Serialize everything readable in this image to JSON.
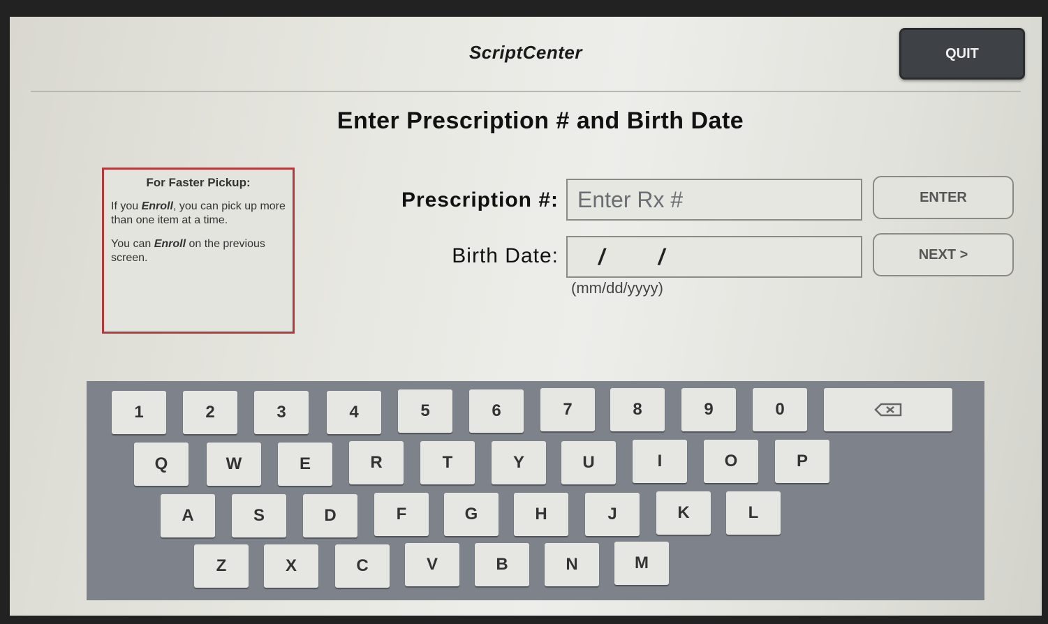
{
  "app": {
    "title": "ScriptCenter",
    "quit_label": "QUIT"
  },
  "page": {
    "title": "Enter Prescription # and Birth Date"
  },
  "info_box": {
    "heading": "For Faster Pickup:",
    "paragraph1_pre": "If you ",
    "paragraph1_em": "Enroll",
    "paragraph1_post": ", you can pick up more than one item at a time.",
    "paragraph2_pre": "You can ",
    "paragraph2_em": "Enroll",
    "paragraph2_post": " on the previous screen."
  },
  "form": {
    "rx_label": "Prescription #:",
    "rx_placeholder": "Enter Rx #",
    "rx_value": "",
    "birth_label": "Birth Date:",
    "birth_value": "/ /",
    "birth_hint": "(mm/dd/yyyy)",
    "enter_label": "ENTER",
    "next_label": "NEXT >"
  },
  "keyboard": {
    "row1": [
      "1",
      "2",
      "3",
      "4",
      "5",
      "6",
      "7",
      "8",
      "9",
      "0"
    ],
    "row2": [
      "Q",
      "W",
      "E",
      "R",
      "T",
      "Y",
      "U",
      "I",
      "O",
      "P"
    ],
    "row3": [
      "A",
      "S",
      "D",
      "F",
      "G",
      "H",
      "J",
      "K",
      "L"
    ],
    "row4": [
      "Z",
      "X",
      "C",
      "V",
      "B",
      "N",
      "M"
    ],
    "backspace_icon": "backspace-icon"
  },
  "colors": {
    "quit_bg": "#3e4247",
    "info_border": "#b33a3a",
    "keyboard_bg": "#7d828b",
    "screen_bg": "#e8e8e2"
  }
}
